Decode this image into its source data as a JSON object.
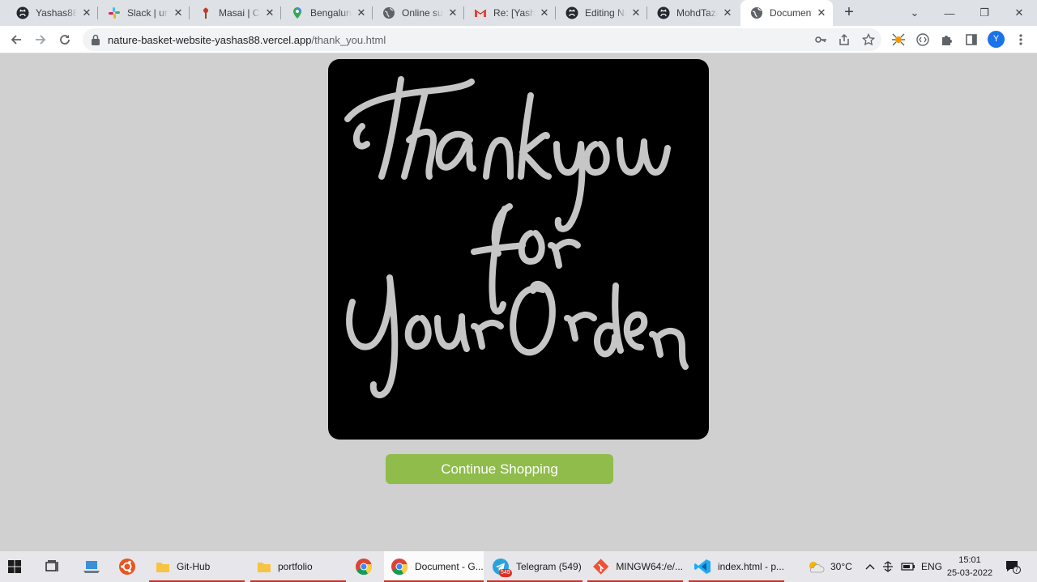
{
  "browser": {
    "tabs": [
      {
        "title": "Yashas88/",
        "favicon": "github-icon"
      },
      {
        "title": "Slack | unit",
        "favicon": "slack-icon"
      },
      {
        "title": "Masai | Co",
        "favicon": "masai-icon"
      },
      {
        "title": "Bengaluru",
        "favicon": "maps-pin-icon"
      },
      {
        "title": "Online sup",
        "favicon": "globe-icon"
      },
      {
        "title": "Re: [Yashas",
        "favicon": "gmail-icon"
      },
      {
        "title": "Editing Na",
        "favicon": "github-icon"
      },
      {
        "title": "MohdTaza",
        "favicon": "github-icon"
      },
      {
        "title": "Document",
        "favicon": "globe-icon",
        "active": true
      }
    ],
    "url_domain": "nature-basket-website-yashas88.vercel.app",
    "url_path": "/thank_you.html",
    "profile_initial": "Y"
  },
  "page": {
    "image_alt_text": "Thankyou for Your Order",
    "continue_label": "Continue Shopping",
    "button_color": "#8fbc4a",
    "background_color": "#d0d0d0"
  },
  "taskbar": {
    "apps": [
      {
        "label": "Git-Hub",
        "icon": "folder-icon"
      },
      {
        "label": "portfolio",
        "icon": "folder-icon"
      },
      {
        "label": "",
        "icon": "chrome-icon"
      },
      {
        "label": "Document - G...",
        "icon": "chrome-icon",
        "active": true
      },
      {
        "label": "Telegram (549)",
        "icon": "telegram-icon",
        "badge": "549"
      },
      {
        "label": "MINGW64:/e/...",
        "icon": "git-icon"
      },
      {
        "label": "index.html - p...",
        "icon": "vscode-icon"
      }
    ],
    "weather": "30°C",
    "language": "ENG",
    "time": "15:01",
    "date": "25-03-2022",
    "notification_count": "7"
  }
}
